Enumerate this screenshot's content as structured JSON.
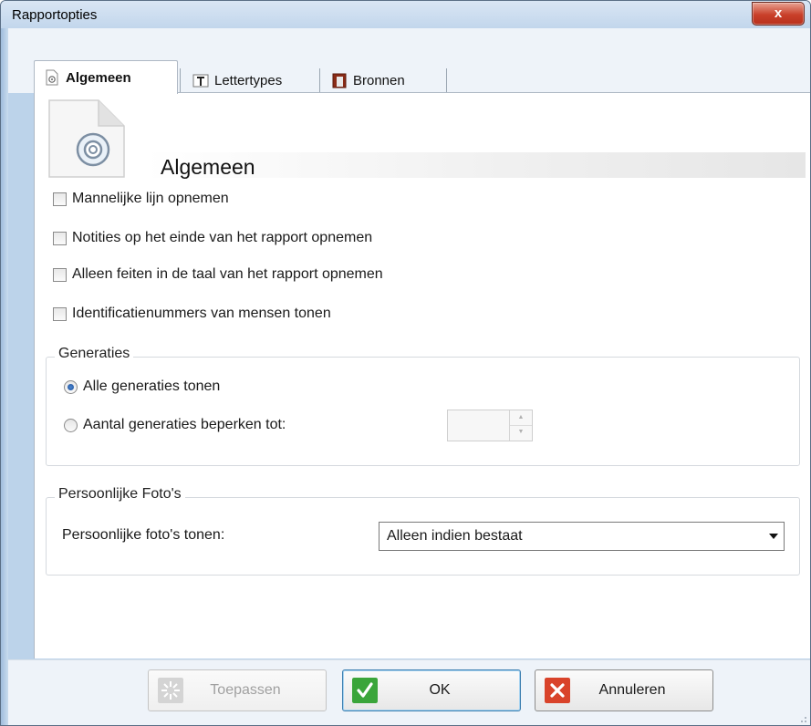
{
  "window": {
    "title": "Rapportopties",
    "close_label": "x"
  },
  "tabs": [
    {
      "label": "Algemeen",
      "icon": "report-settings-icon",
      "active": true
    },
    {
      "label": "Lettertypes",
      "icon": "text-font-icon",
      "active": false
    },
    {
      "label": "Bronnen",
      "icon": "source-book-icon",
      "active": false
    }
  ],
  "section": {
    "title": "Algemeen",
    "icon": "document-gear-icon"
  },
  "options": [
    {
      "label": "Mannelijke lijn opnemen",
      "checked": false
    },
    {
      "label": "Notities op het einde van het rapport opnemen",
      "checked": false
    },
    {
      "label": "Alleen feiten in de taal van het rapport opnemen",
      "checked": false
    },
    {
      "label": "Identificatienummers van mensen tonen",
      "checked": false
    }
  ],
  "generations": {
    "legend": "Generaties",
    "options": [
      {
        "label": "Alle generaties tonen",
        "checked": true
      },
      {
        "label": "Aantal generaties beperken tot:",
        "checked": false
      }
    ],
    "limit_value": ""
  },
  "photos": {
    "legend": "Persoonlijke Foto's",
    "label": "Persoonlijke foto's tonen:",
    "selected": "Alleen indien bestaat"
  },
  "buttons": {
    "apply": {
      "label": "Toepassen",
      "enabled": false,
      "icon": "sparkle-icon"
    },
    "ok": {
      "label": "OK",
      "icon": "check-icon",
      "color": "#3aa53a"
    },
    "cancel": {
      "label": "Annuleren",
      "icon": "x-icon",
      "color": "#d9432a"
    }
  }
}
